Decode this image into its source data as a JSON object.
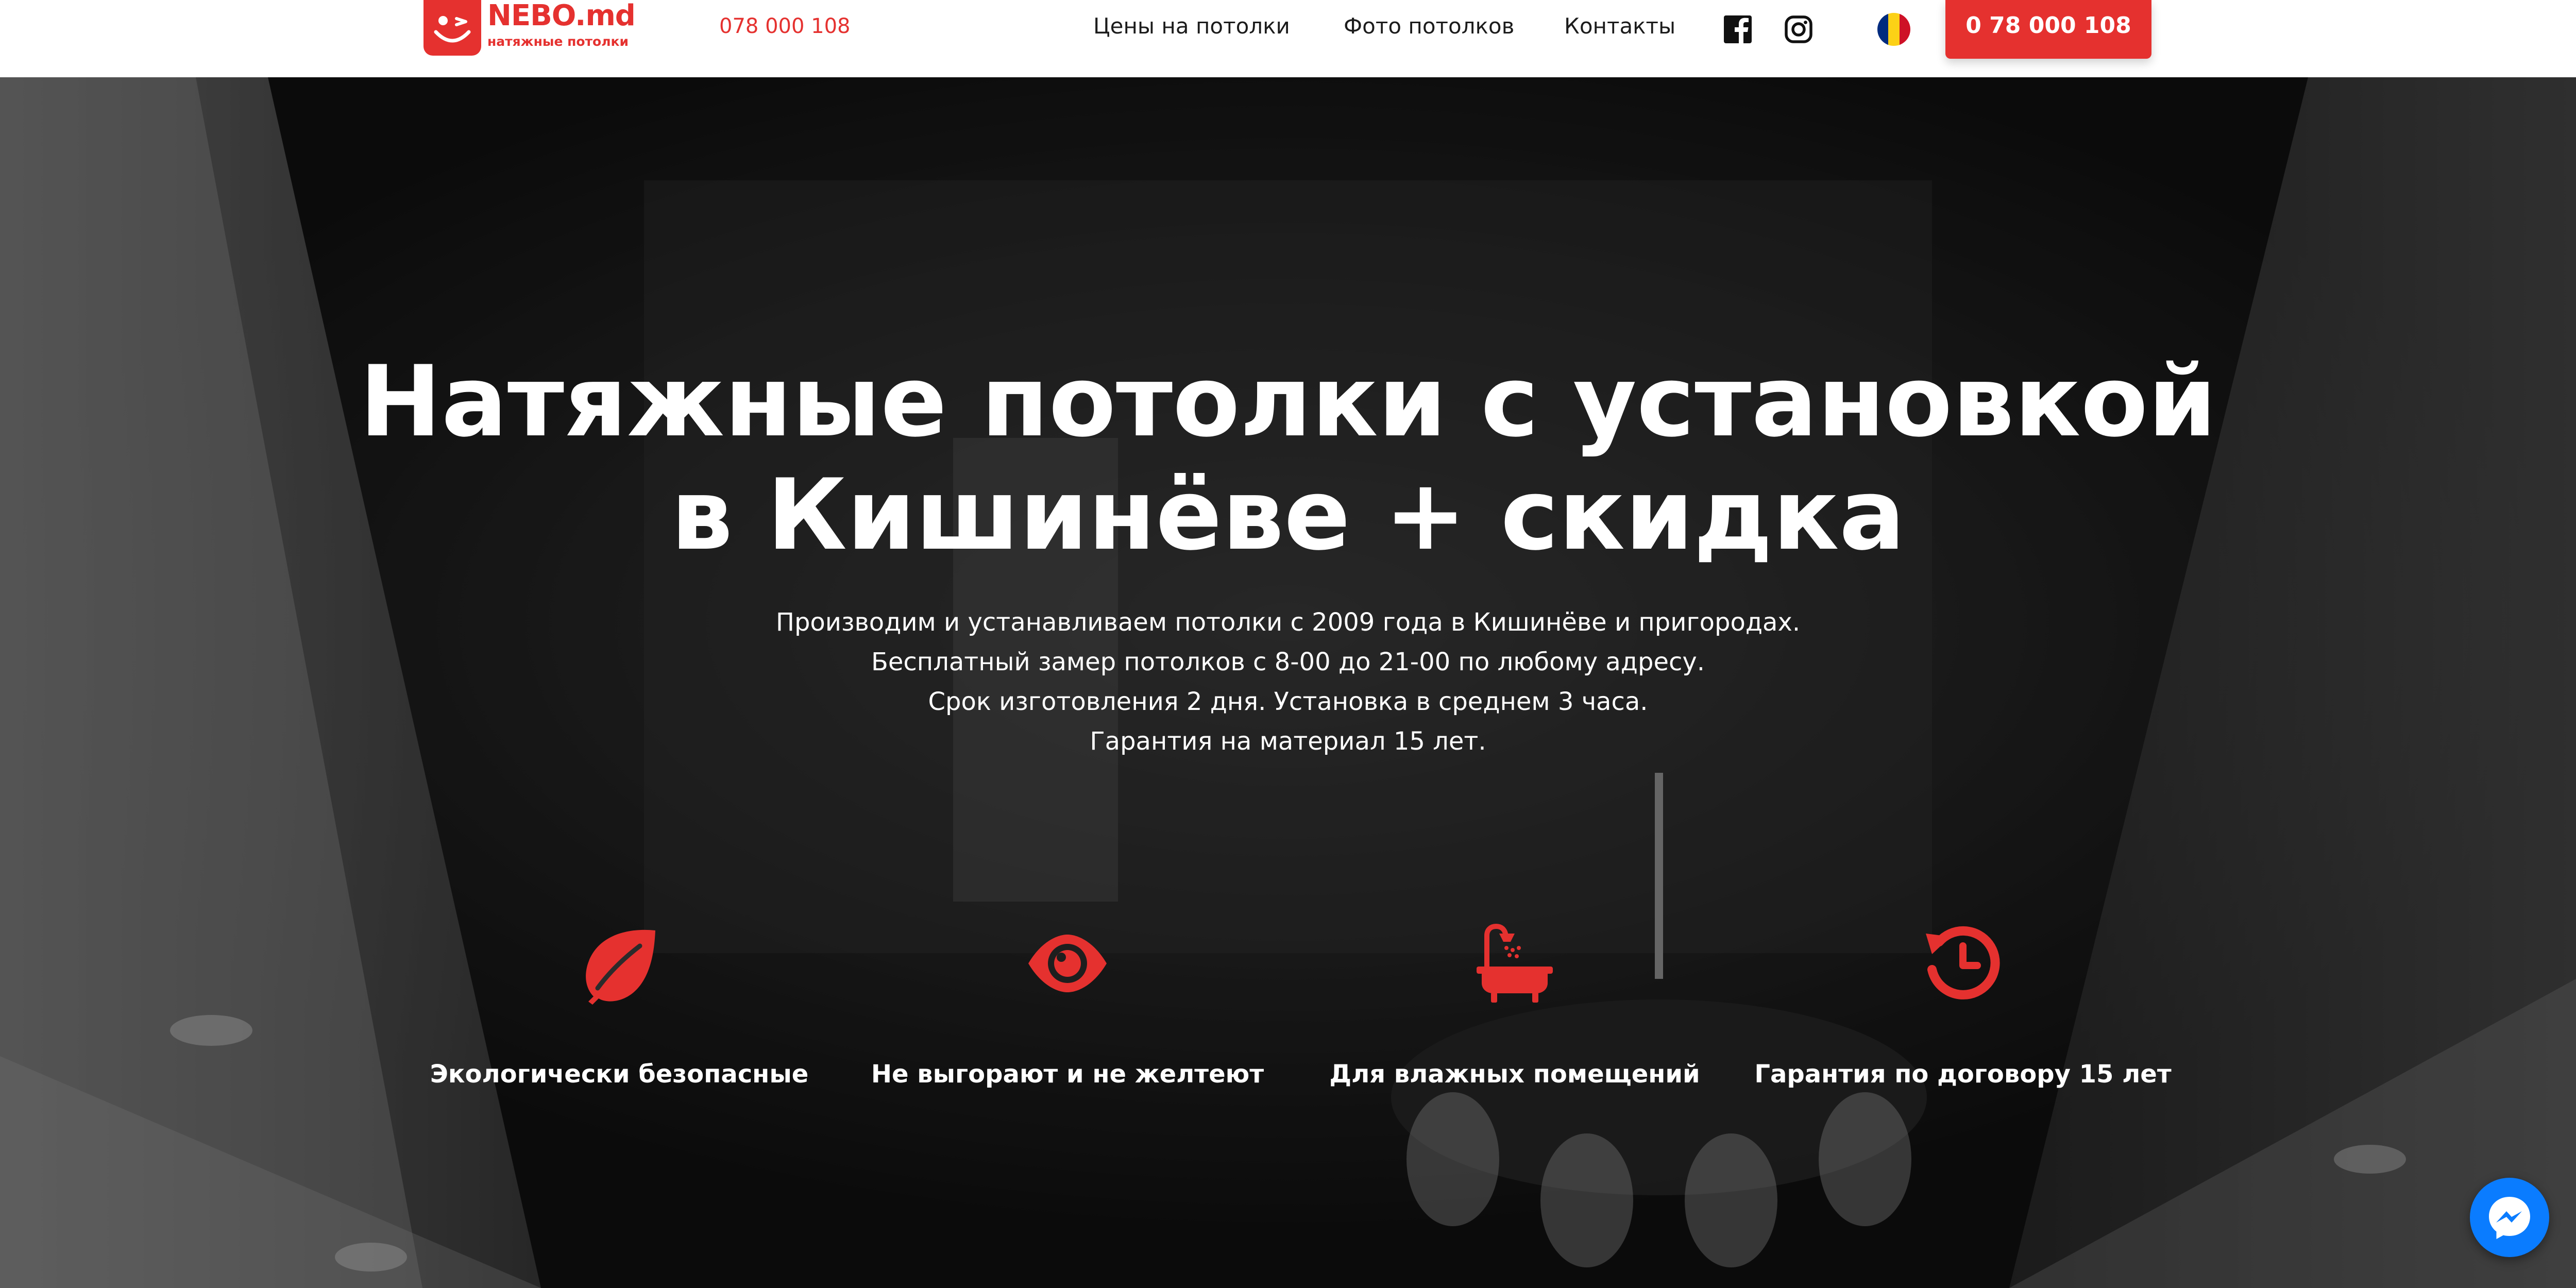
{
  "header": {
    "logo": {
      "name": "NEBO.md",
      "tagline": "натяжные потолки"
    },
    "phone": "078 000 108",
    "nav": [
      {
        "label": "Цены на потолки"
      },
      {
        "label": "Фото потолков"
      },
      {
        "label": "Контакты"
      }
    ],
    "social": [
      {
        "icon": "facebook-icon"
      },
      {
        "icon": "instagram-icon"
      }
    ],
    "language": {
      "icon": "romanian-flag-icon",
      "colors": [
        "#002b7f",
        "#fcd116",
        "#ce1126"
      ]
    },
    "cta_button": "0 78 000 108"
  },
  "hero": {
    "title_lines": [
      "Натяжные потолки с установкой",
      "в Кишинёве + скидка"
    ],
    "text_lines": [
      "Производим и устанавливаем потолки с 2009 года в Кишинёве и пригородах.",
      "Бесплатный замер потолков с 8-00 до 21-00 по любому адресу.",
      "Срок изготовления 2 дня. Установка в среднем 3 часа.",
      "Гарантия на материал 15 лет."
    ],
    "features": [
      {
        "icon": "leaf-icon",
        "label": "Экологически безопасные"
      },
      {
        "icon": "eye-icon",
        "label": "Не выгорают и не желтеют"
      },
      {
        "icon": "bathtub-icon",
        "label": "Для влажных помещений"
      },
      {
        "icon": "history-clock-icon",
        "label": "Гарантия по договору 15 лет"
      }
    ]
  },
  "messenger": {
    "icon": "messenger-icon"
  },
  "colors": {
    "accent": "#e5312f",
    "messenger": "#0a7cff",
    "header_bg": "#ffffff",
    "hero_text": "#ffffff"
  }
}
